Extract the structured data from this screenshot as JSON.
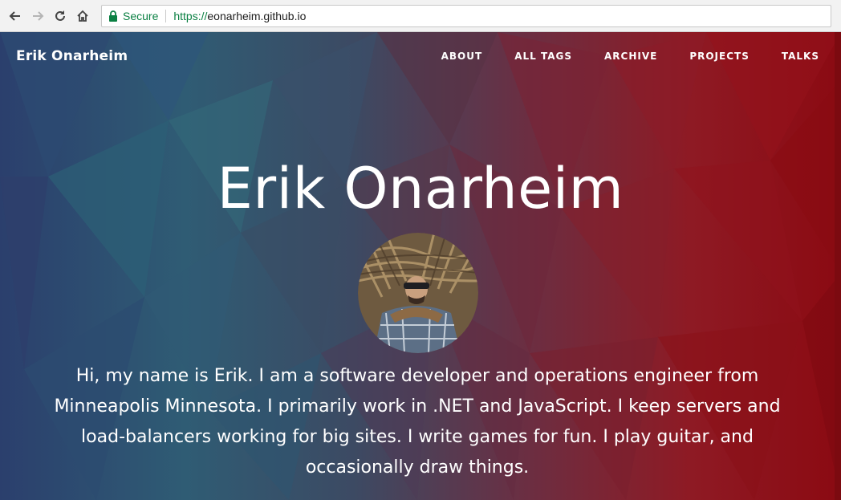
{
  "browser": {
    "secure_label": "Secure",
    "url_scheme": "https://",
    "url_host": "eonarheim.github.io"
  },
  "site": {
    "brand": "Erik Onarheim",
    "menu": [
      "ABOUT",
      "ALL TAGS",
      "ARCHIVE",
      "PROJECTS",
      "TALKS"
    ]
  },
  "hero": {
    "title": "Erik Onarheim",
    "bio": "Hi, my name is Erik. I am a software developer and operations engineer from Minneapolis Minnesota. I primarily work in .NET and JavaScript. I keep servers and load-balancers working for big sites. I write games for fun. I play guitar, and occasionally draw things."
  },
  "colors": {
    "secure_green": "#0b8043",
    "bg_left": "#2b3f6d",
    "bg_right": "#8b0a12"
  },
  "icons": {
    "back": "back-arrow-icon",
    "forward": "forward-arrow-icon",
    "reload": "reload-icon",
    "home": "home-icon",
    "lock": "lock-icon"
  }
}
